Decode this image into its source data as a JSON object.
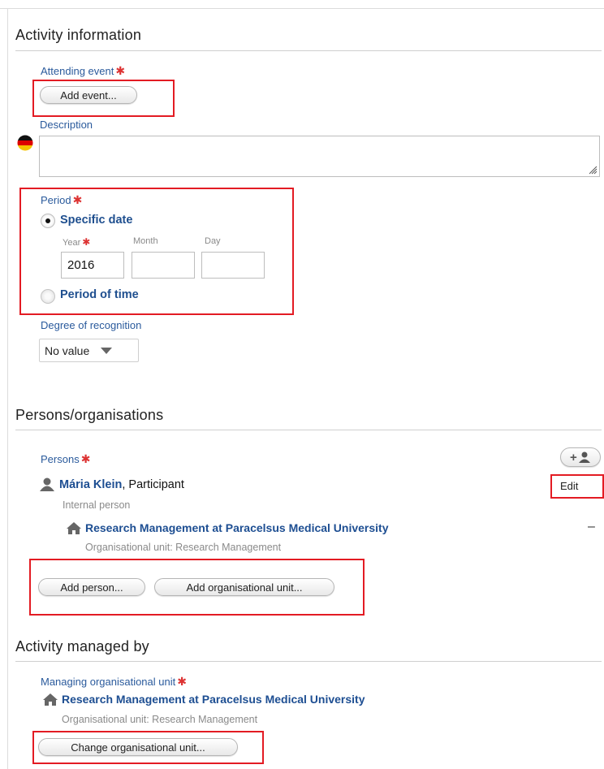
{
  "sections": {
    "activity_info": "Activity information",
    "persons_orgs": "Persons/organisations",
    "managed_by": "Activity managed by"
  },
  "attending_event": {
    "label": "Attending event",
    "required": "✱",
    "button": "Add event..."
  },
  "description": {
    "label": "Description",
    "flag": "germany-flag-icon",
    "value": ""
  },
  "period": {
    "label": "Period",
    "required": "✱",
    "specific_date": "Specific date",
    "period_of_time": "Period of time",
    "selected": "Specific date",
    "year_label": "Year",
    "month_label": "Month",
    "day_label": "Day",
    "year_value": "2016",
    "month_value": "",
    "day_value": ""
  },
  "recognition": {
    "label": "Degree of recognition",
    "value": "No value"
  },
  "persons": {
    "label": "Persons",
    "required": "✱",
    "add_icon": "+♟",
    "person_name": "Mária Klein",
    "person_role": ", Participant",
    "person_type": "Internal person",
    "edit": "Edit",
    "org_name": "Research Management at Paracelsus Medical University",
    "org_sub": "Organisational unit: Research Management",
    "remove": "–",
    "add_person": "Add person...",
    "add_org": "Add organisational unit..."
  },
  "managed": {
    "label": "Managing organisational unit",
    "required": "✱",
    "org_name": "Research Management at Paracelsus Medical University",
    "org_sub": "Organisational unit: Research Management",
    "change": "Change organisational unit..."
  },
  "colors": {
    "link": "#1d4e92",
    "label": "#2a5a9c",
    "required": "#dd3333",
    "highlight": "#e31b23"
  }
}
